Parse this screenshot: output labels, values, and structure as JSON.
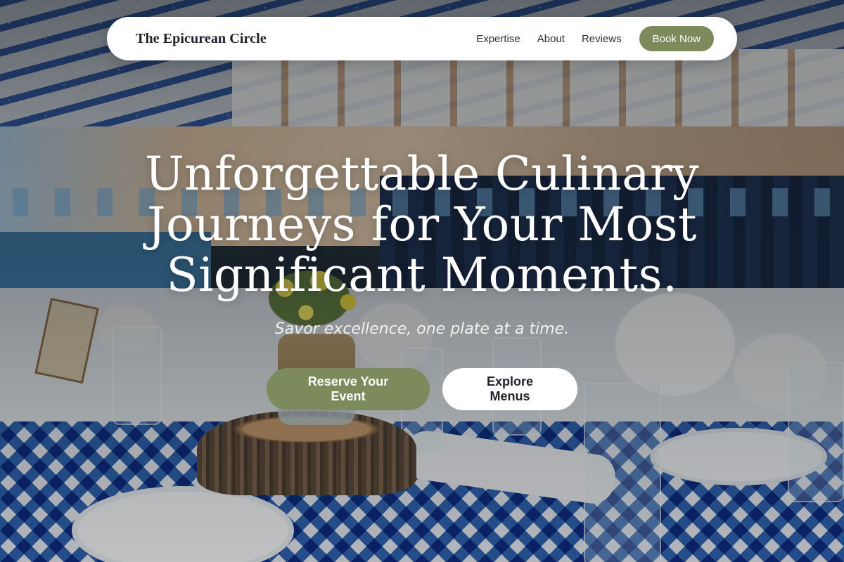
{
  "nav": {
    "brand": "The Epicurean Circle",
    "links": [
      "Expertise",
      "About",
      "Reviews"
    ],
    "cta_label": "Book Now"
  },
  "hero": {
    "headline": "Unforgettable Culinary Journeys for Your Most Significant Moments.",
    "tagline": "Savor excellence, one plate at a time.",
    "primary_button": "Reserve Your Event",
    "secondary_button": "Explore Menus"
  },
  "colors": {
    "accent": "#7d8a5c",
    "nav_background": "#ffffff",
    "text_dark": "#1f2328",
    "hero_text": "#ffffff"
  }
}
